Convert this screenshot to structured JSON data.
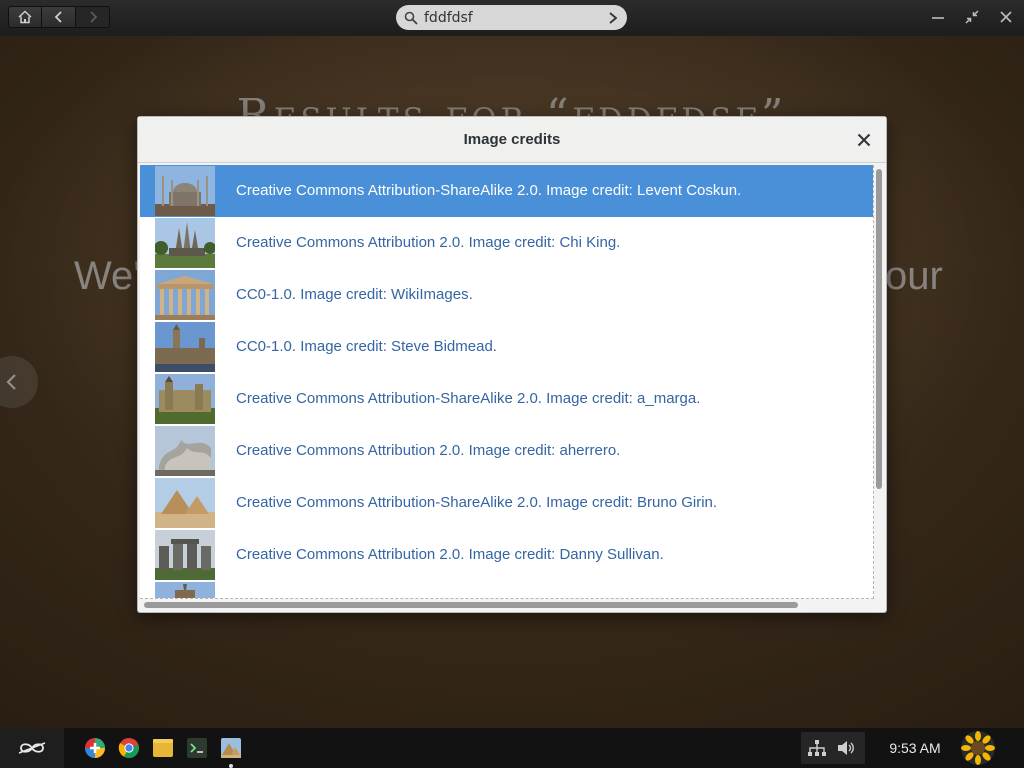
{
  "titlebar": {
    "search_value": "fddfdsf"
  },
  "background": {
    "title": "Results for “fddfdsf”",
    "subtitle_left": "We'",
    "subtitle_right": "our"
  },
  "dialog": {
    "title": "Image credits",
    "items": [
      {
        "label": "Creative Commons Attribution-ShareAlike 2.0. Image credit: Levent Coskun.",
        "selected": true
      },
      {
        "label": "Creative Commons Attribution 2.0. Image credit: Chi King."
      },
      {
        "label": "CC0-1.0. Image credit: WikiImages."
      },
      {
        "label": "CC0-1.0. Image credit: Steve Bidmead."
      },
      {
        "label": "Creative Commons Attribution-ShareAlike 2.0. Image credit: a_marga."
      },
      {
        "label": "Creative Commons Attribution 2.0. Image credit: aherrero."
      },
      {
        "label": "Creative Commons Attribution-ShareAlike 2.0. Image credit: Bruno Girin."
      },
      {
        "label": "Creative Commons Attribution 2.0. Image credit: Danny Sullivan."
      }
    ]
  },
  "taskbar": {
    "clock": "9:53 AM"
  },
  "colors": {
    "selection": "#4a90d9",
    "link_text": "#3465a4",
    "taskbar": "#121212"
  }
}
